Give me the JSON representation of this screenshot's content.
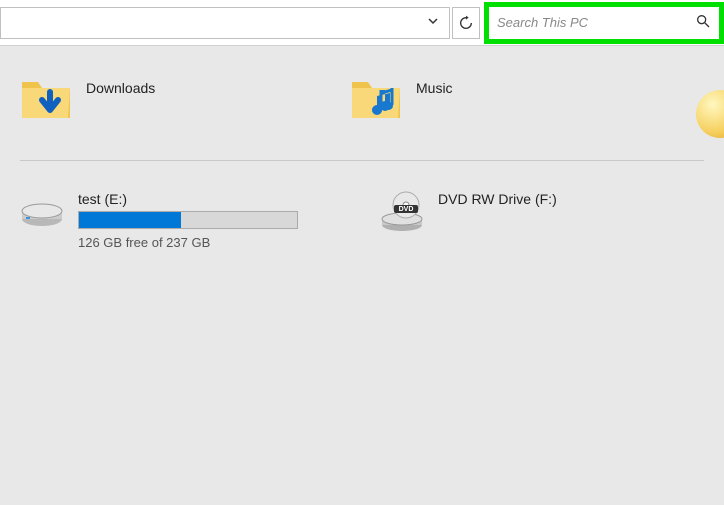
{
  "toolbar": {
    "search_placeholder": "Search This PC"
  },
  "folders": {
    "downloads": {
      "label": "Downloads"
    },
    "music": {
      "label": "Music"
    }
  },
  "drives": {
    "test": {
      "name": "test (E:)",
      "free_text": "126 GB free of 237 GB",
      "fill_percent": 47
    },
    "dvd": {
      "name": "DVD RW Drive (F:)"
    }
  }
}
